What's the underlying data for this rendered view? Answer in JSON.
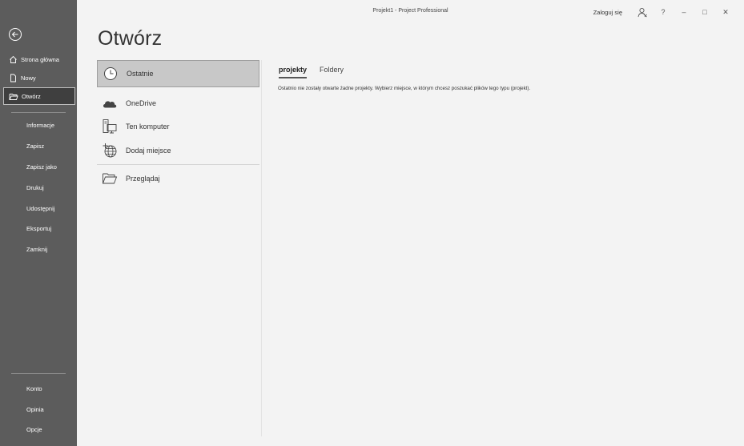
{
  "window": {
    "title": "Projekt1  -  Project Professional",
    "login_label": "Zaloguj się",
    "help_label": "?",
    "minimize_label": "–",
    "maximize_label": "□",
    "close_label": "✕"
  },
  "sidebar": {
    "home_label": "Strona główna",
    "new_label": "Nowy",
    "open_label": "Otwórz",
    "items": [
      "Informacje",
      "Zapisz",
      "Zapisz jako",
      "Drukuj",
      "Udostępnij",
      "Eksportuj",
      "Zamknij"
    ],
    "bottom_items": [
      "Konto",
      "Opinia",
      "Opcje"
    ]
  },
  "main": {
    "page_title": "Otwórz",
    "locations": [
      "Ostatnie",
      "OneDrive",
      "Ten komputer",
      "Dodaj miejsce",
      "Przeglądaj"
    ],
    "tabs": [
      "projekty",
      "Foldery"
    ],
    "empty_message": "Ostatnio nie zostały otwarte żadne projekty. Wybierz miejsce, w którym chcesz poszukać plików tego typu (projekt)."
  }
}
